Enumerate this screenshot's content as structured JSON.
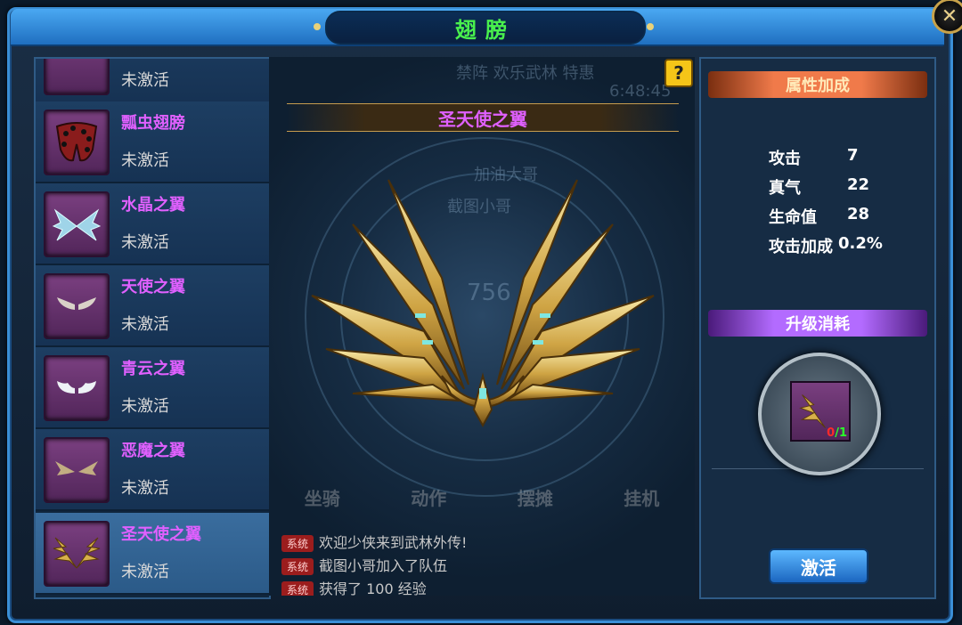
{
  "window": {
    "title": "翅膀",
    "close_icon": "close-icon"
  },
  "wing_list": [
    {
      "name": "",
      "status": "未激活",
      "icon": "wing-icon-partial"
    },
    {
      "name": "瓢虫翅膀",
      "status": "未激活",
      "icon": "ladybug-wing-icon"
    },
    {
      "name": "水晶之翼",
      "status": "未激活",
      "icon": "crystal-wing-icon"
    },
    {
      "name": "天使之翼",
      "status": "未激活",
      "icon": "angel-wing-icon"
    },
    {
      "name": "青云之翼",
      "status": "未激活",
      "icon": "cloud-wing-icon"
    },
    {
      "name": "恶魔之翼",
      "status": "未激活",
      "icon": "demon-wing-icon"
    },
    {
      "name": "圣天使之翼",
      "status": "未激活",
      "icon": "holy-angel-wing-icon",
      "selected": true
    }
  ],
  "preview": {
    "title": "圣天使之翼",
    "help": "?",
    "background_text": {
      "tabs": "禁阵  欢乐武林  特惠",
      "time": "6:48:45",
      "guild": "加油大哥",
      "player": "截图小哥",
      "level": "756"
    },
    "bottom_menu": [
      "坐骑",
      "动作",
      "摆摊",
      "挂机"
    ],
    "chat": [
      {
        "tag": "系统",
        "text": "欢迎少侠来到武林外传!"
      },
      {
        "tag": "系统",
        "text": "截图小哥加入了队伍"
      },
      {
        "tag": "系统",
        "text": "获得了 100 经验"
      }
    ]
  },
  "attributes": {
    "header": "属性加成",
    "rows": [
      {
        "label": "攻击",
        "value": "7"
      },
      {
        "label": "真气",
        "value": "22"
      },
      {
        "label": "生命值",
        "value": "28"
      },
      {
        "label": "攻击加成",
        "value": "0.2%"
      }
    ]
  },
  "upgrade": {
    "header": "升级消耗",
    "item_icon": "holy-angel-wing-icon",
    "have": "0",
    "need": "1",
    "colors": {
      "have": "#ff2a2a",
      "need": "#2aff2a"
    }
  },
  "activate_button": "激活"
}
